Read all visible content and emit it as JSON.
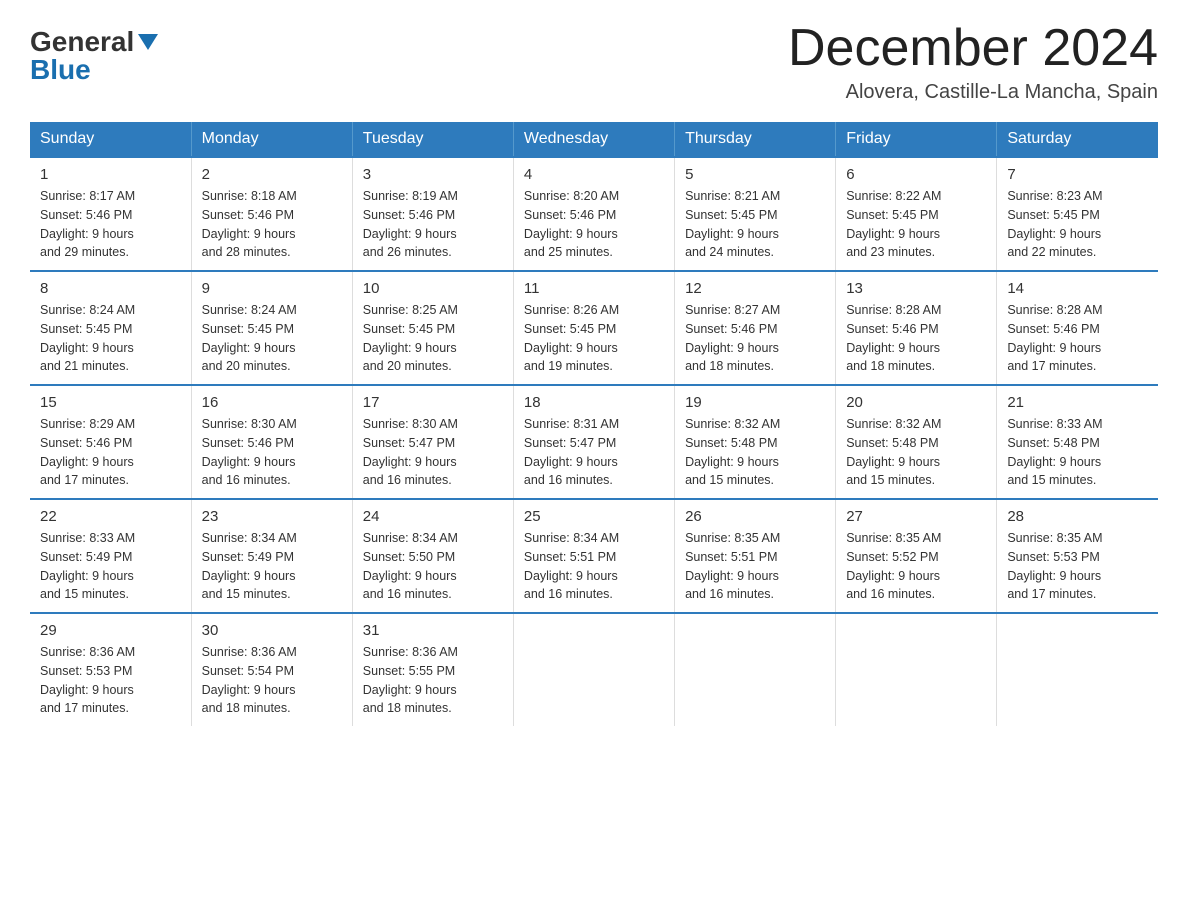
{
  "header": {
    "logo_general": "General",
    "logo_blue": "Blue",
    "month_title": "December 2024",
    "location": "Alovera, Castille-La Mancha, Spain"
  },
  "weekdays": [
    "Sunday",
    "Monday",
    "Tuesday",
    "Wednesday",
    "Thursday",
    "Friday",
    "Saturday"
  ],
  "weeks": [
    [
      {
        "day": "1",
        "sunrise": "8:17 AM",
        "sunset": "5:46 PM",
        "daylight": "9 hours and 29 minutes."
      },
      {
        "day": "2",
        "sunrise": "8:18 AM",
        "sunset": "5:46 PM",
        "daylight": "9 hours and 28 minutes."
      },
      {
        "day": "3",
        "sunrise": "8:19 AM",
        "sunset": "5:46 PM",
        "daylight": "9 hours and 26 minutes."
      },
      {
        "day": "4",
        "sunrise": "8:20 AM",
        "sunset": "5:46 PM",
        "daylight": "9 hours and 25 minutes."
      },
      {
        "day": "5",
        "sunrise": "8:21 AM",
        "sunset": "5:45 PM",
        "daylight": "9 hours and 24 minutes."
      },
      {
        "day": "6",
        "sunrise": "8:22 AM",
        "sunset": "5:45 PM",
        "daylight": "9 hours and 23 minutes."
      },
      {
        "day": "7",
        "sunrise": "8:23 AM",
        "sunset": "5:45 PM",
        "daylight": "9 hours and 22 minutes."
      }
    ],
    [
      {
        "day": "8",
        "sunrise": "8:24 AM",
        "sunset": "5:45 PM",
        "daylight": "9 hours and 21 minutes."
      },
      {
        "day": "9",
        "sunrise": "8:24 AM",
        "sunset": "5:45 PM",
        "daylight": "9 hours and 20 minutes."
      },
      {
        "day": "10",
        "sunrise": "8:25 AM",
        "sunset": "5:45 PM",
        "daylight": "9 hours and 20 minutes."
      },
      {
        "day": "11",
        "sunrise": "8:26 AM",
        "sunset": "5:45 PM",
        "daylight": "9 hours and 19 minutes."
      },
      {
        "day": "12",
        "sunrise": "8:27 AM",
        "sunset": "5:46 PM",
        "daylight": "9 hours and 18 minutes."
      },
      {
        "day": "13",
        "sunrise": "8:28 AM",
        "sunset": "5:46 PM",
        "daylight": "9 hours and 18 minutes."
      },
      {
        "day": "14",
        "sunrise": "8:28 AM",
        "sunset": "5:46 PM",
        "daylight": "9 hours and 17 minutes."
      }
    ],
    [
      {
        "day": "15",
        "sunrise": "8:29 AM",
        "sunset": "5:46 PM",
        "daylight": "9 hours and 17 minutes."
      },
      {
        "day": "16",
        "sunrise": "8:30 AM",
        "sunset": "5:46 PM",
        "daylight": "9 hours and 16 minutes."
      },
      {
        "day": "17",
        "sunrise": "8:30 AM",
        "sunset": "5:47 PM",
        "daylight": "9 hours and 16 minutes."
      },
      {
        "day": "18",
        "sunrise": "8:31 AM",
        "sunset": "5:47 PM",
        "daylight": "9 hours and 16 minutes."
      },
      {
        "day": "19",
        "sunrise": "8:32 AM",
        "sunset": "5:48 PM",
        "daylight": "9 hours and 15 minutes."
      },
      {
        "day": "20",
        "sunrise": "8:32 AM",
        "sunset": "5:48 PM",
        "daylight": "9 hours and 15 minutes."
      },
      {
        "day": "21",
        "sunrise": "8:33 AM",
        "sunset": "5:48 PM",
        "daylight": "9 hours and 15 minutes."
      }
    ],
    [
      {
        "day": "22",
        "sunrise": "8:33 AM",
        "sunset": "5:49 PM",
        "daylight": "9 hours and 15 minutes."
      },
      {
        "day": "23",
        "sunrise": "8:34 AM",
        "sunset": "5:49 PM",
        "daylight": "9 hours and 15 minutes."
      },
      {
        "day": "24",
        "sunrise": "8:34 AM",
        "sunset": "5:50 PM",
        "daylight": "9 hours and 16 minutes."
      },
      {
        "day": "25",
        "sunrise": "8:34 AM",
        "sunset": "5:51 PM",
        "daylight": "9 hours and 16 minutes."
      },
      {
        "day": "26",
        "sunrise": "8:35 AM",
        "sunset": "5:51 PM",
        "daylight": "9 hours and 16 minutes."
      },
      {
        "day": "27",
        "sunrise": "8:35 AM",
        "sunset": "5:52 PM",
        "daylight": "9 hours and 16 minutes."
      },
      {
        "day": "28",
        "sunrise": "8:35 AM",
        "sunset": "5:53 PM",
        "daylight": "9 hours and 17 minutes."
      }
    ],
    [
      {
        "day": "29",
        "sunrise": "8:36 AM",
        "sunset": "5:53 PM",
        "daylight": "9 hours and 17 minutes."
      },
      {
        "day": "30",
        "sunrise": "8:36 AM",
        "sunset": "5:54 PM",
        "daylight": "9 hours and 18 minutes."
      },
      {
        "day": "31",
        "sunrise": "8:36 AM",
        "sunset": "5:55 PM",
        "daylight": "9 hours and 18 minutes."
      },
      null,
      null,
      null,
      null
    ]
  ],
  "labels": {
    "sunrise": "Sunrise:",
    "sunset": "Sunset:",
    "daylight": "Daylight:"
  }
}
